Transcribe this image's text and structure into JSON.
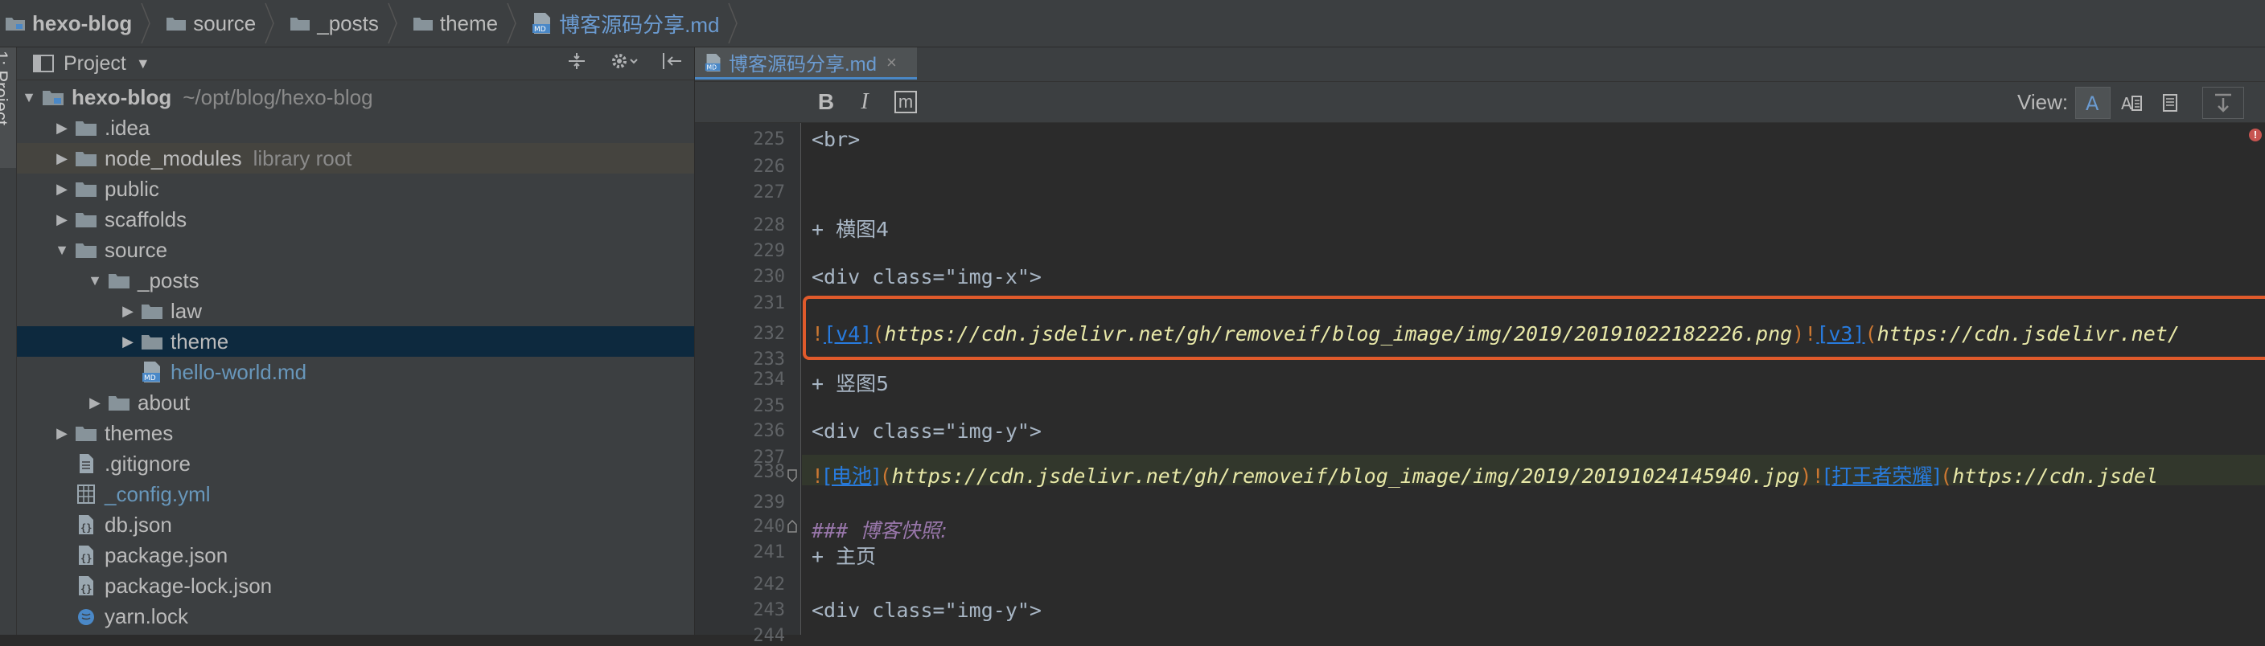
{
  "breadcrumb": {
    "items": [
      {
        "label": "hexo-blog",
        "kind": "project"
      },
      {
        "label": "source",
        "kind": "folder"
      },
      {
        "label": "_posts",
        "kind": "folder"
      },
      {
        "label": "theme",
        "kind": "folder"
      },
      {
        "label": "博客源码分享.md",
        "kind": "md"
      }
    ]
  },
  "toolstrip": {
    "tab_label": "1: Project"
  },
  "project_panel": {
    "title": "Project",
    "tools": [
      "collapse-icon",
      "gear-icon",
      "hide-icon"
    ],
    "tree": [
      {
        "label": "hexo-blog",
        "hint": "~/opt/blog/hexo-blog",
        "depth": 0,
        "arrow": "open",
        "icon": "module-folder"
      },
      {
        "label": ".idea",
        "hint": "",
        "depth": 1,
        "arrow": "closed",
        "icon": "folder"
      },
      {
        "label": "node_modules",
        "hint": "library root",
        "depth": 1,
        "arrow": "closed",
        "icon": "folder"
      },
      {
        "label": "public",
        "hint": "",
        "depth": 1,
        "arrow": "closed",
        "icon": "folder"
      },
      {
        "label": "scaffolds",
        "hint": "",
        "depth": 1,
        "arrow": "closed",
        "icon": "folder"
      },
      {
        "label": "source",
        "hint": "",
        "depth": 1,
        "arrow": "open",
        "icon": "folder"
      },
      {
        "label": "_posts",
        "hint": "",
        "depth": 2,
        "arrow": "open",
        "icon": "folder"
      },
      {
        "label": "law",
        "hint": "",
        "depth": 3,
        "arrow": "closed",
        "icon": "folder"
      },
      {
        "label": "theme",
        "hint": "",
        "depth": 3,
        "arrow": "closed",
        "icon": "folder"
      },
      {
        "label": "hello-world.md",
        "hint": "",
        "depth": 3,
        "arrow": "none",
        "icon": "md"
      },
      {
        "label": "about",
        "hint": "",
        "depth": 2,
        "arrow": "closed",
        "icon": "folder"
      },
      {
        "label": "themes",
        "hint": "",
        "depth": 1,
        "arrow": "closed",
        "icon": "folder"
      },
      {
        "label": ".gitignore",
        "hint": "",
        "depth": 1,
        "arrow": "none",
        "icon": "file"
      },
      {
        "label": "_config.yml",
        "hint": "",
        "depth": 1,
        "arrow": "none",
        "icon": "yml"
      },
      {
        "label": "db.json",
        "hint": "",
        "depth": 1,
        "arrow": "none",
        "icon": "json"
      },
      {
        "label": "package.json",
        "hint": "",
        "depth": 1,
        "arrow": "none",
        "icon": "json"
      },
      {
        "label": "package-lock.json",
        "hint": "",
        "depth": 1,
        "arrow": "none",
        "icon": "json"
      },
      {
        "label": "yarn.lock",
        "hint": "",
        "depth": 1,
        "arrow": "none",
        "icon": "yarn"
      }
    ]
  },
  "editor": {
    "tab": {
      "label": "博客源码分享.md",
      "close": "×"
    },
    "toolbar": {
      "bold": "B",
      "italic": "I",
      "code": "m",
      "view_label": "View:"
    },
    "line_numbers": [
      "225",
      "226",
      "227",
      "228",
      "229",
      "230",
      "231",
      "232",
      "233",
      "234",
      "235",
      "236",
      "237",
      "238",
      "239",
      "240",
      "241",
      "242",
      "243",
      "244"
    ],
    "lines": {
      "l225": "<br>",
      "l228_plus": "+ ",
      "l228_text": "横图4",
      "l230": "<div class=\"img-x\">",
      "l232": {
        "b1": "!",
        "alt1": "[v4]",
        "u1": "https://cdn.jsdelivr.net/gh/removeif/blog_image/img/2019/20191022182226.png",
        "b2": "!",
        "alt2": "[v3]",
        "u2": "https://cdn.jsdelivr.net/"
      },
      "l234_plus": "+ ",
      "l234_text": "竖图5",
      "l236": "<div class=\"img-y\">",
      "l238": {
        "b1": "!",
        "alt1": "[电池]",
        "u1": "https://cdn.jsdelivr.net/gh/removeif/blog_image/img/2019/20191024145940.jpg",
        "b2": "!",
        "alt2": "[打王者荣耀]",
        "u2": "https://cdn.jsdel"
      },
      "l240_hash": "### ",
      "l240_text": "博客快照:",
      "l241_plus": "+ ",
      "l241_text": "主页",
      "l243": "<div class=\"img-y\">"
    }
  },
  "colors": {
    "accent": "#4a88c7",
    "highlight_box": "#e05a2b",
    "selection": "#0d293e"
  }
}
